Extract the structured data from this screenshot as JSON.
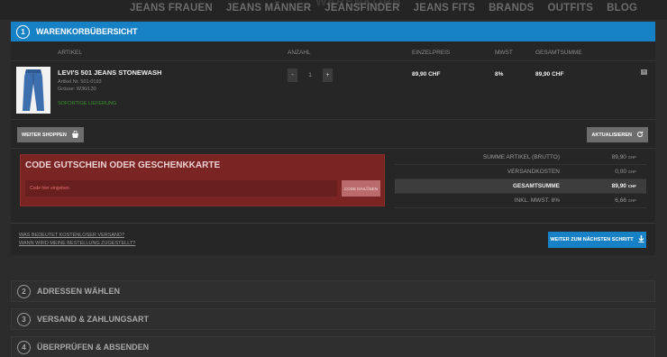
{
  "nav": {
    "ghost_text": "WARENKORB",
    "links": [
      "JEANS FRAUEN",
      "JEANS MÄNNER",
      "JEANSFINDER",
      "JEANS FITS",
      "BRANDS",
      "OUTFITS",
      "BLOG"
    ]
  },
  "step1": {
    "number": "1",
    "title": "WARENKORBÜBERSICHT"
  },
  "columns": {
    "artikel": "ARTIKEL",
    "anzahl": "ANZAHL",
    "einzelpreis": "EINZELPREIS",
    "mwst": "MWST",
    "gesamtsumme": "GESAMTSUMME"
  },
  "item": {
    "title": "LEVI'S 501 JEANS STONEWASH",
    "article_no": "Artikel Nr. 501-0193",
    "size": "Grösse: W36/L30",
    "stock": "SOFORTIGE LIEFERUNG",
    "qty_minus": "-",
    "qty": "1",
    "qty_plus": "+",
    "unit_price": "89,90 CHF",
    "vat": "8%",
    "total": "89,90 CHF",
    "remove": "×"
  },
  "actions": {
    "continue_shopping": "WEITER SHOPPEN",
    "update": "AKTUALISIEREN"
  },
  "coupon": {
    "title": "CODE GUTSCHEIN ODER GESCHENKKARTE",
    "placeholder": "Code hier eingeben",
    "redeem": "CODE EINLÖSEN"
  },
  "totals": [
    {
      "label": "SUMME ARTIKEL (BRUTTO)",
      "value": "89,90",
      "currency": "CHF"
    },
    {
      "label": "VERSANDKOSTEN",
      "value": "0,00",
      "currency": "CHF"
    },
    {
      "label": "GESAMTSUMME",
      "value": "89,90",
      "currency": "CHF"
    },
    {
      "label": "INKL. MWST. 8%",
      "value": "6,66",
      "currency": "CHF"
    }
  ],
  "info": {
    "link1": "WAS BEDEUTET KOSTENLOSER VERSAND?",
    "link2": "WANN WIRD MEINE BESTELLUNG ZUGESTELLT?",
    "next": "WEITER ZUM NÄCHSTEN SCHRITT"
  },
  "steps": [
    {
      "number": "2",
      "title": "ADRESSEN WÄHLEN"
    },
    {
      "number": "3",
      "title": "VERSAND & ZAHLUNGSART"
    },
    {
      "number": "4",
      "title": "ÜBERPRÜFEN & ABSENDEN"
    }
  ],
  "colors": {
    "accent_blue": "#1781c5",
    "coupon_red": "#7a2424",
    "stock_green": "#3a8f2f"
  }
}
